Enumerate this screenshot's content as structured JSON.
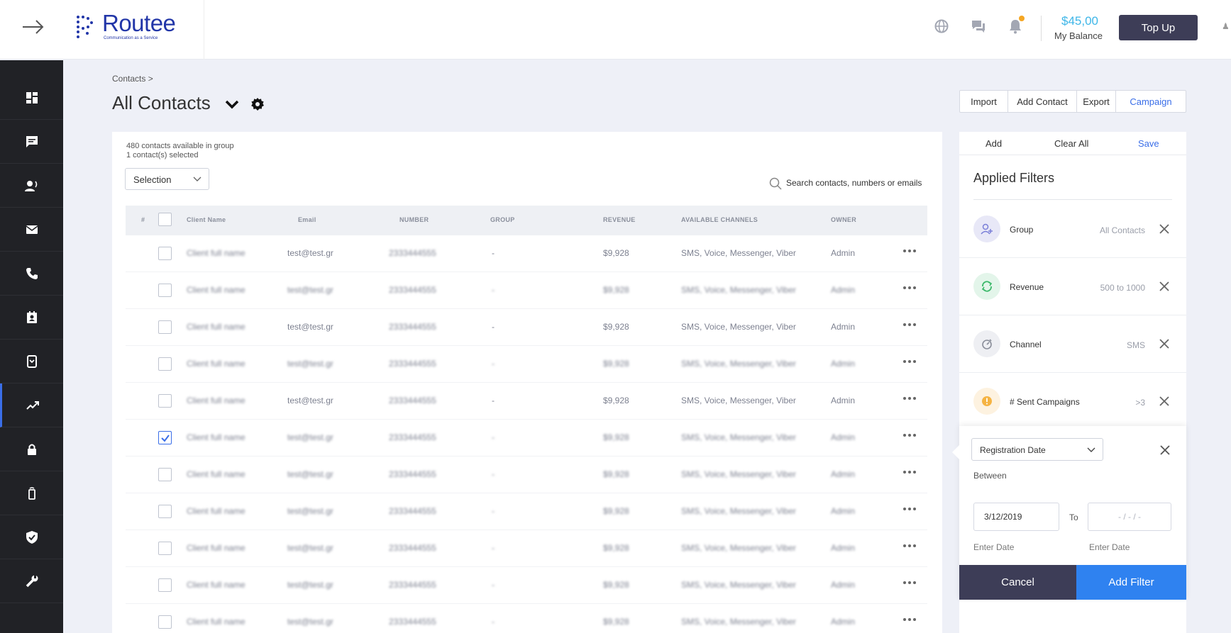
{
  "header": {
    "brand": "Routee",
    "tagline": "Communication as a Service",
    "balance_amount": "$45,00",
    "balance_label": "My Balance",
    "topup_label": "Top Up"
  },
  "sidebar": {
    "items": [
      {
        "icon": "dashboard-icon"
      },
      {
        "icon": "sms-icon"
      },
      {
        "icon": "voice-icon"
      },
      {
        "icon": "email-icon"
      },
      {
        "icon": "phone-icon"
      },
      {
        "icon": "contacts-icon"
      },
      {
        "icon": "number-lookup-icon"
      },
      {
        "icon": "analytics-icon",
        "active": true
      },
      {
        "icon": "lock-icon"
      },
      {
        "icon": "mobile-icon"
      },
      {
        "icon": "shield-icon"
      },
      {
        "icon": "wrench-icon"
      }
    ]
  },
  "page": {
    "breadcrumb": "Contacts >",
    "title": "All Contacts"
  },
  "actions": {
    "import": "Import",
    "add_contact": "Add Contact",
    "export": "Export",
    "campaign": "Campaign"
  },
  "list": {
    "available": "480 contacts available in group",
    "selected": "1 contact(s) selected",
    "selection_label": "Selection",
    "search_placeholder": "Search contacts, numbers or emails"
  },
  "table": {
    "columns": [
      "#",
      "Client Name",
      "Email",
      "NUMBER",
      "GROUP",
      "REVENUE",
      "AVAILABLE CHANNELS",
      "OWNER"
    ],
    "rows": [
      {
        "name": "Client full name",
        "email": "test@test.gr",
        "number": "2333444555",
        "group": "-",
        "revenue": "$9,928",
        "channels": "SMS, Voice, Messenger, Viber",
        "owner": "Admin",
        "checked": false
      },
      {
        "name": "Client full name",
        "email": "test@test.gr",
        "number": "2333444555",
        "group": "-",
        "revenue": "$9,928",
        "channels": "SMS, Voice, Messenger, Viber",
        "owner": "Admin",
        "checked": false
      },
      {
        "name": "Client full name",
        "email": "test@test.gr",
        "number": "2333444555",
        "group": "-",
        "revenue": "$9,928",
        "channels": "SMS, Voice, Messenger, Viber",
        "owner": "Admin",
        "checked": false
      },
      {
        "name": "Client full name",
        "email": "test@test.gr",
        "number": "2333444555",
        "group": "-",
        "revenue": "$9,928",
        "channels": "SMS, Voice, Messenger, Viber",
        "owner": "Admin",
        "checked": false
      },
      {
        "name": "Client full name",
        "email": "test@test.gr",
        "number": "2333444555",
        "group": "-",
        "revenue": "$9,928",
        "channels": "SMS, Voice, Messenger, Viber",
        "owner": "Admin",
        "checked": false
      },
      {
        "name": "Client full name",
        "email": "test@test.gr",
        "number": "2333444555",
        "group": "-",
        "revenue": "$9,928",
        "channels": "SMS, Voice, Messenger, Viber",
        "owner": "Admin",
        "checked": true
      },
      {
        "name": "Client full name",
        "email": "test@test.gr",
        "number": "2333444555",
        "group": "-",
        "revenue": "$9,928",
        "channels": "SMS, Voice, Messenger, Viber",
        "owner": "Admin",
        "checked": false
      },
      {
        "name": "Client full name",
        "email": "test@test.gr",
        "number": "2333444555",
        "group": "-",
        "revenue": "$9,928",
        "channels": "SMS, Voice, Messenger, Viber",
        "owner": "Admin",
        "checked": false
      },
      {
        "name": "Client full name",
        "email": "test@test.gr",
        "number": "2333444555",
        "group": "-",
        "revenue": "$9,928",
        "channels": "SMS, Voice, Messenger, Viber",
        "owner": "Admin",
        "checked": false
      },
      {
        "name": "Client full name",
        "email": "test@test.gr",
        "number": "2333444555",
        "group": "-",
        "revenue": "$9,928",
        "channels": "SMS, Voice, Messenger, Viber",
        "owner": "Admin",
        "checked": false
      },
      {
        "name": "Client full name",
        "email": "test@test.gr",
        "number": "2333444555",
        "group": "-",
        "revenue": "$9,928",
        "channels": "SMS, Voice, Messenger, Viber",
        "owner": "Admin",
        "checked": false
      }
    ]
  },
  "filters": {
    "add": "Add",
    "clear_all": "Clear All",
    "save": "Save",
    "title": "Applied Filters",
    "items": [
      {
        "label": "Group",
        "value": "All Contacts",
        "icon": "add-user-icon",
        "color": "#e8e8f7"
      },
      {
        "label": "Revenue",
        "value": "500 to 1000",
        "icon": "refresh-icon",
        "color": "#e3f5ea"
      },
      {
        "label": "Channel",
        "value": "SMS",
        "icon": "timer-icon",
        "color": "#eeeff3"
      },
      {
        "label": "# Sent Campaigns",
        "value": ">3",
        "icon": "warning-icon",
        "color": "#fdf2e0"
      }
    ]
  },
  "date_filter": {
    "field": "Registration Date",
    "between": "Between",
    "from_value": "3/12/2019",
    "to_label": "To",
    "to_placeholder": "- / - / -",
    "enter_date": "Enter Date",
    "cancel": "Cancel",
    "add_filter": "Add Filter"
  },
  "colors": {
    "brand": "#2236a8",
    "accent": "#2f82f0",
    "dark_button": "#3d3d57",
    "balance": "#3db6e8"
  }
}
